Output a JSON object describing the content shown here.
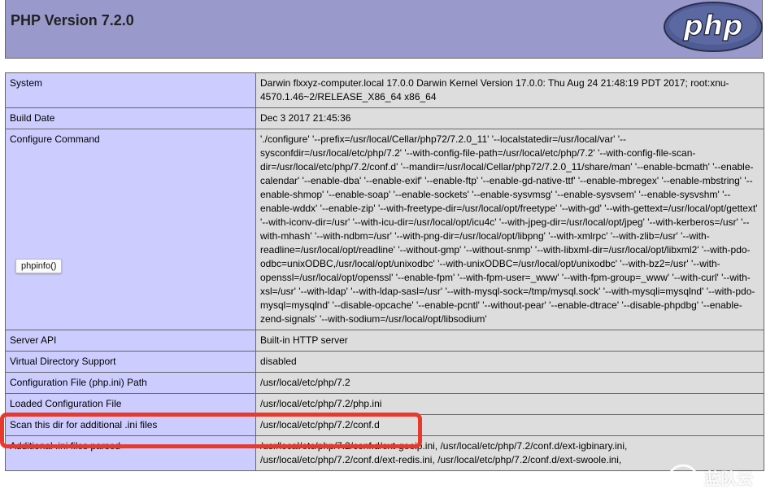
{
  "header": {
    "title": "PHP Version 7.2.0",
    "logo_text": "php"
  },
  "rows": [
    {
      "label": "System",
      "value": "Darwin flxxyz-computer.local 17.0.0 Darwin Kernel Version 17.0.0: Thu Aug 24 21:48:19 PDT 2017; root:xnu-4570.1.46~2/RELEASE_X86_64 x86_64"
    },
    {
      "label": "Build Date",
      "value": "Dec 3 2017 21:45:36"
    },
    {
      "label": "Configure Command",
      "value": "'./configure' '--prefix=/usr/local/Cellar/php72/7.2.0_11' '--localstatedir=/usr/local/var' '--sysconfdir=/usr/local/etc/php/7.2' '--with-config-file-path=/usr/local/etc/php/7.2' '--with-config-file-scan-dir=/usr/local/etc/php/7.2/conf.d' '--mandir=/usr/local/Cellar/php72/7.2.0_11/share/man' '--enable-bcmath' '--enable-calendar' '--enable-dba' '--enable-exif' '--enable-ftp' '--enable-gd-native-ttf' '--enable-mbregex' '--enable-mbstring' '--enable-shmop' '--enable-soap' '--enable-sockets' '--enable-sysvmsg' '--enable-sysvsem' '--enable-sysvshm' '--enable-wddx' '--enable-zip' '--with-freetype-dir=/usr/local/opt/freetype' '--with-gd' '--with-gettext=/usr/local/opt/gettext' '--with-iconv-dir=/usr' '--with-icu-dir=/usr/local/opt/icu4c' '--with-jpeg-dir=/usr/local/opt/jpeg' '--with-kerberos=/usr' '--with-mhash' '--with-ndbm=/usr' '--with-png-dir=/usr/local/opt/libpng' '--with-xmlrpc' '--with-zlib=/usr' '--with-readline=/usr/local/opt/readline' '--without-gmp' '--without-snmp' '--with-libxml-dir=/usr/local/opt/libxml2' '--with-pdo-odbc=unixODBC,/usr/local/opt/unixodbc' '--with-unixODBC=/usr/local/opt/unixodbc' '--with-bz2=/usr' '--with-openssl=/usr/local/opt/openssl' '--enable-fpm' '--with-fpm-user=_www' '--with-fpm-group=_www' '--with-curl' '--with-xsl=/usr' '--with-ldap' '--with-ldap-sasl=/usr' '--with-mysql-sock=/tmp/mysql.sock' '--with-mysqli=mysqlnd' '--with-pdo-mysql=mysqlnd' '--disable-opcache' '--enable-pcntl' '--without-pear' '--enable-dtrace' '--disable-phpdbg' '--enable-zend-signals' '--with-sodium=/usr/local/opt/libsodium'"
    },
    {
      "label": "Server API",
      "value": "Built-in HTTP server"
    },
    {
      "label": "Virtual Directory Support",
      "value": "disabled"
    },
    {
      "label": "Configuration File (php.ini) Path",
      "value": "/usr/local/etc/php/7.2"
    },
    {
      "label": "Loaded Configuration File",
      "value": "/usr/local/etc/php/7.2/php.ini"
    },
    {
      "label": "Scan this dir for additional .ini files",
      "value": "/usr/local/etc/php/7.2/conf.d"
    },
    {
      "label": "Additional .ini files parsed",
      "value": "/usr/local/etc/php/7.2/conf.d/ext-geoip.ini, /usr/local/etc/php/7.2/conf.d/ext-igbinary.ini, /usr/local/etc/php/7.2/conf.d/ext-redis.ini, /usr/local/etc/php/7.2/conf.d/ext-swoole.ini,"
    }
  ],
  "tooltip": "phpinfo()",
  "watermark": {
    "text": "蓝队云",
    "sub": "www.landui.com"
  },
  "colors": {
    "header_bg": "#9999cc",
    "label_bg": "#ccccff",
    "value_bg": "#dddddd",
    "highlight": "#e8392c",
    "logo_bg": "#4f5b93"
  }
}
